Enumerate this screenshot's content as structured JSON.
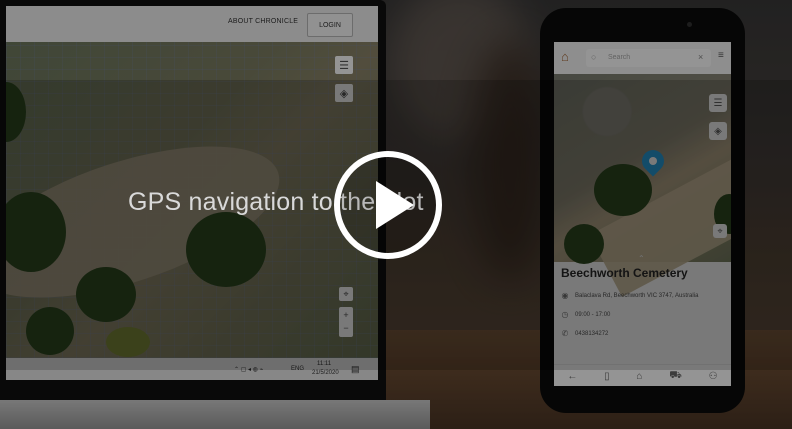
{
  "laptop": {
    "nav": {
      "about_label": "ABOUT CHRONICLE",
      "login_label": "LOGIN"
    },
    "taskbar": {
      "lang": "ENG",
      "time": "11:11",
      "date": "21/5/2020"
    }
  },
  "phone": {
    "search": {
      "placeholder": "Search"
    },
    "place": {
      "name": "Beechworth Cemetery",
      "address": "Balaclava Rd, Beechworth VIC 3747, Australia",
      "hours": "09:00 - 17:00",
      "phone": "0438134272"
    }
  },
  "overlay": {
    "caption": "GPS navigation to the plot"
  },
  "colors": {
    "pin": "#2aa0dd",
    "overlay": "#000000"
  }
}
